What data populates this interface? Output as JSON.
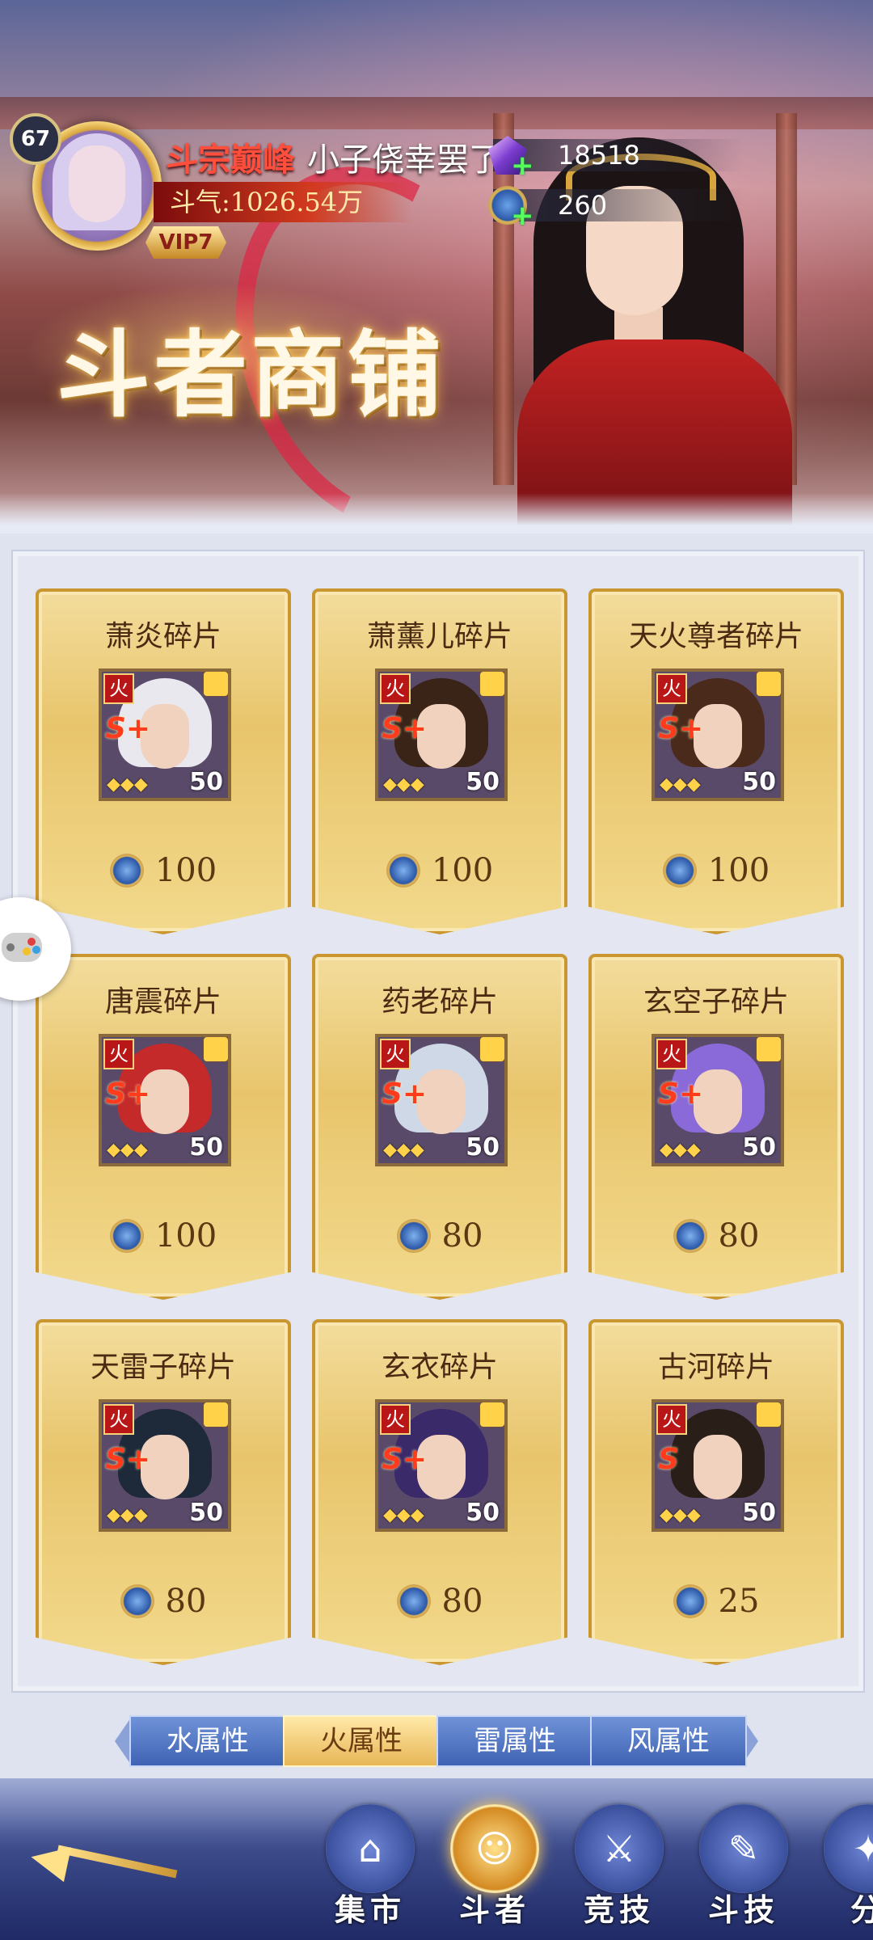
{
  "player": {
    "level": "67",
    "rank_title": "斗宗巅峰",
    "name": "小子侥幸罢了",
    "power": "斗气:1026.54万",
    "vip": "VIP7"
  },
  "currencies": [
    {
      "icon": "gem-icon",
      "value": "18518"
    },
    {
      "icon": "coin-icon",
      "value": "260"
    }
  ],
  "shop_title": "斗者商铺",
  "items": [
    {
      "name": "萧炎碎片",
      "element": "火",
      "grade": "S+",
      "stars": 3,
      "shards": "50",
      "price": "100",
      "hair": "#e8e8ee"
    },
    {
      "name": "萧薰儿碎片",
      "element": "火",
      "grade": "S+",
      "stars": 3,
      "shards": "50",
      "price": "100",
      "hair": "#3a2418"
    },
    {
      "name": "天火尊者碎片",
      "element": "火",
      "grade": "S+",
      "stars": 3,
      "shards": "50",
      "price": "100",
      "hair": "#4a2a1a"
    },
    {
      "name": "唐震碎片",
      "element": "火",
      "grade": "S+",
      "stars": 3,
      "shards": "50",
      "price": "100",
      "hair": "#c42a2a"
    },
    {
      "name": "药老碎片",
      "element": "火",
      "grade": "S+",
      "stars": 3,
      "shards": "50",
      "price": "80",
      "hair": "#cfd8e6"
    },
    {
      "name": "玄空子碎片",
      "element": "火",
      "grade": "S+",
      "stars": 3,
      "shards": "50",
      "price": "80",
      "hair": "#8a6ad8"
    },
    {
      "name": "天雷子碎片",
      "element": "火",
      "grade": "S+",
      "stars": 3,
      "shards": "50",
      "price": "80",
      "hair": "#1e2a3a"
    },
    {
      "name": "玄衣碎片",
      "element": "火",
      "grade": "S+",
      "stars": 3,
      "shards": "50",
      "price": "80",
      "hair": "#3b2a6a"
    },
    {
      "name": "古河碎片",
      "element": "火",
      "grade": "S",
      "stars": 3,
      "shards": "50",
      "price": "25",
      "hair": "#2a1e18"
    }
  ],
  "tabs": [
    {
      "label": "水属性",
      "active": false
    },
    {
      "label": "火属性",
      "active": true
    },
    {
      "label": "雷属性",
      "active": false
    },
    {
      "label": "风属性",
      "active": false
    }
  ],
  "nav": [
    {
      "label": "集市",
      "icon": "market-icon",
      "glyph": "⌂",
      "active": false
    },
    {
      "label": "斗者",
      "icon": "fighter-icon",
      "glyph": "☺",
      "active": true
    },
    {
      "label": "竞技",
      "icon": "arena-icon",
      "glyph": "⚔",
      "active": false
    },
    {
      "label": "斗技",
      "icon": "skill-book-icon",
      "glyph": "✎",
      "active": false
    },
    {
      "label": "分",
      "icon": "share-icon",
      "glyph": "✦",
      "active": false
    }
  ],
  "colors": {
    "card_gold": "#e8c56c",
    "tab_blue": "#3f63b3",
    "tab_active": "#e7b656",
    "rank_red": "#ff4f3c"
  }
}
